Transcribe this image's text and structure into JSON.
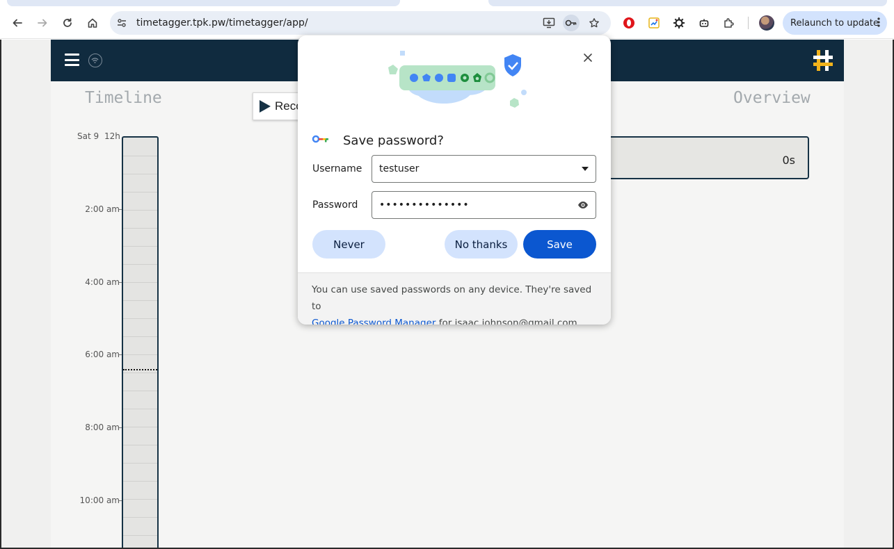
{
  "browser": {
    "url": "timetagger.tpk.pw/timetagger/app/",
    "relaunch_label": "Relaunch to update"
  },
  "app": {
    "timeline_title": "Timeline",
    "overview_title": "Overview",
    "record_label": "Reco",
    "overview_total": "0s",
    "timeline_top_date": "Sat 9",
    "timeline_top_zoom": "12h",
    "ticks": [
      "2:00 am",
      "4:00 am",
      "6:00 am",
      "8:00 am",
      "10:00 am"
    ]
  },
  "dialog": {
    "title": "Save password?",
    "username_label": "Username",
    "username_value": "testuser",
    "password_label": "Password",
    "password_value": "••••••••••••••",
    "never_label": "Never",
    "no_thanks_label": "No thanks",
    "save_label": "Save",
    "footer_text_1": "You can use saved passwords on any device. They're saved to",
    "footer_link": "Google Password Manager",
    "footer_text_2": " for isaac.johnson@gmail.com."
  },
  "colors": {
    "header_bg": "#102b3f",
    "primary_button": "#0b57d0",
    "tonal_button": "#d3e3fd",
    "logo_accent": "#f2b31b"
  }
}
